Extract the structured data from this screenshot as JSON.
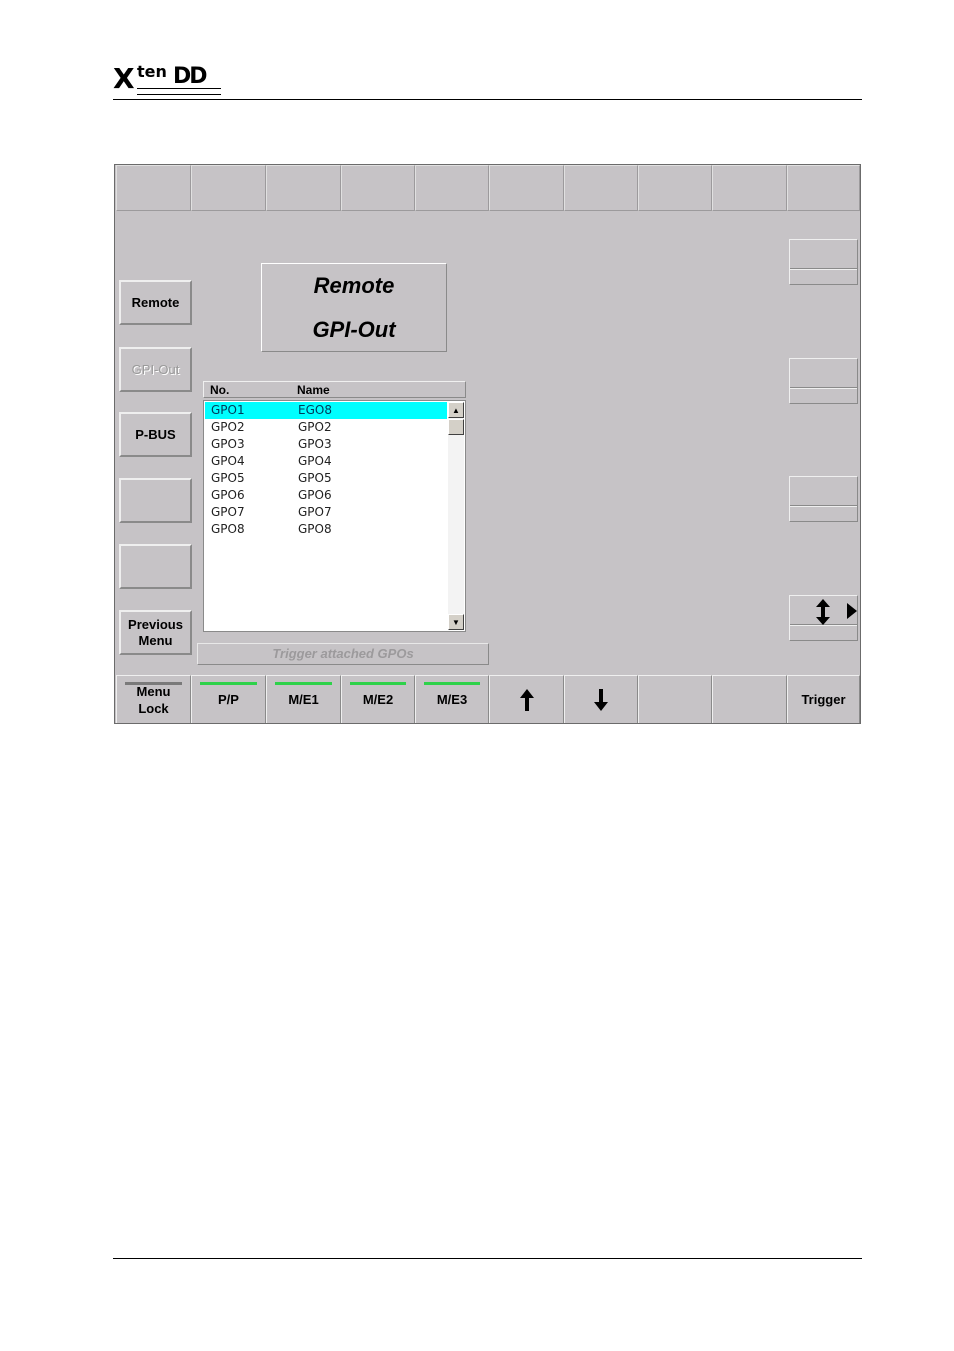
{
  "header": {
    "logo_text_x": "X",
    "logo_text_ten": "ten",
    "logo_text_dd": "DD"
  },
  "top_row": {
    "cells": [
      "",
      "",
      "",
      "",
      "",
      "",
      "",
      "",
      "",
      ""
    ]
  },
  "left_menu": {
    "remote": "Remote",
    "gpi_out": "GPI-Out",
    "pbus": "P-BUS",
    "empty1": "",
    "empty2": "",
    "previous_menu": "Previous\nMenu"
  },
  "title": {
    "line1": "Remote",
    "line2": "GPI-Out"
  },
  "gpo_list": {
    "headers": {
      "no": "No.",
      "name": "Name"
    },
    "rows": [
      {
        "no": "GPO1",
        "name": "EGO8",
        "selected": true
      },
      {
        "no": "GPO2",
        "name": "GPO2"
      },
      {
        "no": "GPO3",
        "name": "GPO3"
      },
      {
        "no": "GPO4",
        "name": "GPO4"
      },
      {
        "no": "GPO5",
        "name": "GPO5"
      },
      {
        "no": "GPO6",
        "name": "GPO6"
      },
      {
        "no": "GPO7",
        "name": "GPO7"
      },
      {
        "no": "GPO8",
        "name": "GPO8"
      }
    ],
    "selected_color": "#00ffff"
  },
  "status": {
    "text": "Trigger attached GPOs"
  },
  "right_controls": {
    "updown_icon": "up-down-arrow-icon",
    "right_icon": "play-right-icon"
  },
  "bottom_bar": {
    "menu_lock": "Menu\nLock",
    "pp": "P/P",
    "me1": "M/E1",
    "me2": "M/E2",
    "me3": "M/E3",
    "up_icon": "up-arrow-icon",
    "down_icon": "down-arrow-icon",
    "empty1": "",
    "empty2": "",
    "trigger": "Trigger",
    "active_color": "#2ed24a"
  }
}
